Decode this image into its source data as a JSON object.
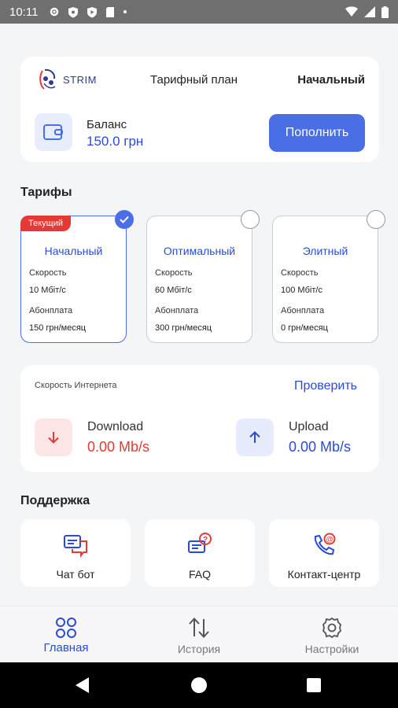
{
  "status_bar": {
    "time": "10:11"
  },
  "header": {
    "brand": "STRIM",
    "plan_label": "Тарифный план",
    "plan_value": "Начальный",
    "balance_label": "Баланс",
    "balance_value": "150.0 грн",
    "topup_label": "Пополнить"
  },
  "tariffs": {
    "title": "Тарифы",
    "items": [
      {
        "badge": "Текущий",
        "name": "Начальный",
        "speed_label": "Скорость",
        "speed": "10 Мбіт/с",
        "fee_label": "Абонплата",
        "fee": "150 грн/месяц",
        "selected": true
      },
      {
        "name": "Оптимальный",
        "speed_label": "Скорость",
        "speed": "60 Мбіт/с",
        "fee_label": "Абонплата",
        "fee": "300 грн/месяц",
        "selected": false
      },
      {
        "name": "Элитный",
        "speed_label": "Скорость",
        "speed": "100 Мбіт/с",
        "fee_label": "Абонплата",
        "fee": "0 грн/месяц",
        "selected": false
      }
    ]
  },
  "speed_test": {
    "title": "Скорость Интернета",
    "check_label": "Проверить",
    "download_label": "Download",
    "download_value": "0.00 Mb/s",
    "upload_label": "Upload",
    "upload_value": "0.00 Mb/s"
  },
  "support": {
    "title": "Поддержка",
    "items": [
      {
        "label": "Чат бот",
        "icon": "chat-bot-icon"
      },
      {
        "label": "FAQ",
        "icon": "faq-icon"
      },
      {
        "label": "Контакт-центр",
        "icon": "contact-center-icon"
      }
    ]
  },
  "bottom_nav": {
    "items": [
      {
        "label": "Главная",
        "icon": "home-grid-icon",
        "active": true
      },
      {
        "label": "История",
        "icon": "history-arrows-icon",
        "active": false
      },
      {
        "label": "Настройки",
        "icon": "settings-gear-icon",
        "active": false
      }
    ]
  },
  "colors": {
    "accent": "#4a6ee6",
    "link": "#2b4bd6",
    "danger": "#e53935"
  }
}
